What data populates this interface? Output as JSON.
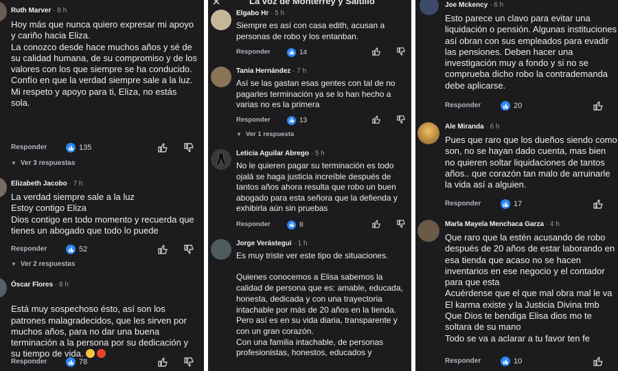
{
  "ui": {
    "reply_label": "Responder",
    "accent_color": "#2d86f5",
    "background": "#1c1c1f"
  },
  "col2_header": "La voz de Monterrey y Saltillo",
  "col1": [
    {
      "author": "Ruth Marver",
      "time": "8 h",
      "text": "Hoy más que nunca quiero expresar mi apoyo y cariño hacia Eliza.\nLa conozco desde hace muchos años y sé de su calidad humana, de su compromiso y de los valores con los que siempre se ha conducido.\nConfío en que la verdad siempre sale a la luz.\nMi respeto y apoyo para ti, Eliza, no estás sola.",
      "likes": "135",
      "replies": "Ver 3 respuestas"
    },
    {
      "author": "Elizabeth Jacobo",
      "time": "7 h",
      "text": "La verdad siempre sale a la luz\nEstoy contigo Eliza\nDios contigo en todo momento y recuerda que tienes un abogado que todo lo puede",
      "likes": "52",
      "replies": "Ver 2 respuestas"
    },
    {
      "author": "Óscar Flores",
      "time": "8 h",
      "text": "Está muy sospechoso ésto, así son los patrones malagradecidos, que les sirven por muchos años, para no dar una buena terminación a la persona por su dedicación y su tiempo de vida.",
      "likes": "78"
    }
  ],
  "col2": [
    {
      "author": "Elgabo Hr",
      "time": "5 h",
      "text": "Siempre es así con casa edith, acusan a personas de robo y los entanban.",
      "likes": "14"
    },
    {
      "author": "Tania Hernández",
      "time": "7 h",
      "text": "Así se las gastan esas gentes con tal de no pagarles terminación ya se lo han hecho a varias no es la primera",
      "likes": "13",
      "replies": "Ver 1 respuesta"
    },
    {
      "author": "Leticia Aguilar Abrego",
      "time": "5 h",
      "text": "No le quieren pagar su terminación es todo ojalá se haga justicia increíble después de tantos años ahora resulta que robo un buen abogado para esta señora que la defienda y exhibirla aún sin pruebas",
      "likes": "8"
    },
    {
      "author": "Jorge Verástegui",
      "time": "1 h",
      "text": "Es muy triste ver este tipo de situaciones.\n\nQuienes conocemos a Elisa sabemos la calidad de persona que es: amable, educada, honesta, dedicada y con una trayectoria intachable por más de 20 años en la tienda.\nPero así es en su vida diaria, transparente y con un gran corazón.\nCon una familia intachable, de personas profesionistas, honestos, educados y"
    }
  ],
  "col3": [
    {
      "author": "Joe Mckency",
      "time": "6 h",
      "text": "Esto parece un clavo para evitar una liquidación o pensión. Algunas instituciones así obran con sus empleados para evadir las pensiones. Deben hacer una investigación muy a fondo y si no se comprueba dicho robo la contrademanda debe aplicarse.",
      "likes": "20"
    },
    {
      "author": "Ale Miranda",
      "time": "6 h",
      "text": "Pues que raro que los dueños siendo como son, no se hayan dado cuenta, mas bien no quieren soltar liquidaciones de tantos años.. que corazón tan malo de arruinarle la vida así a alguien.",
      "likes": "17"
    },
    {
      "author": "Marla Mayela Menchaca Garza",
      "time": "4 h",
      "text": "Que raro que la estén acusando de robo después de 20 años de estar laborando en esa tienda que acaso no se hacen inventarios en ese negocio y el contador para que esta\nAcuérdense que el que mal obra mal le va\nEl karma existe y la Justicia Divina tmb\nQue Dios te bendiga Elisa dios mo te soltara de su mano\nTodo se va a aclarar a tu favor ten fe",
      "likes": "10"
    }
  ]
}
